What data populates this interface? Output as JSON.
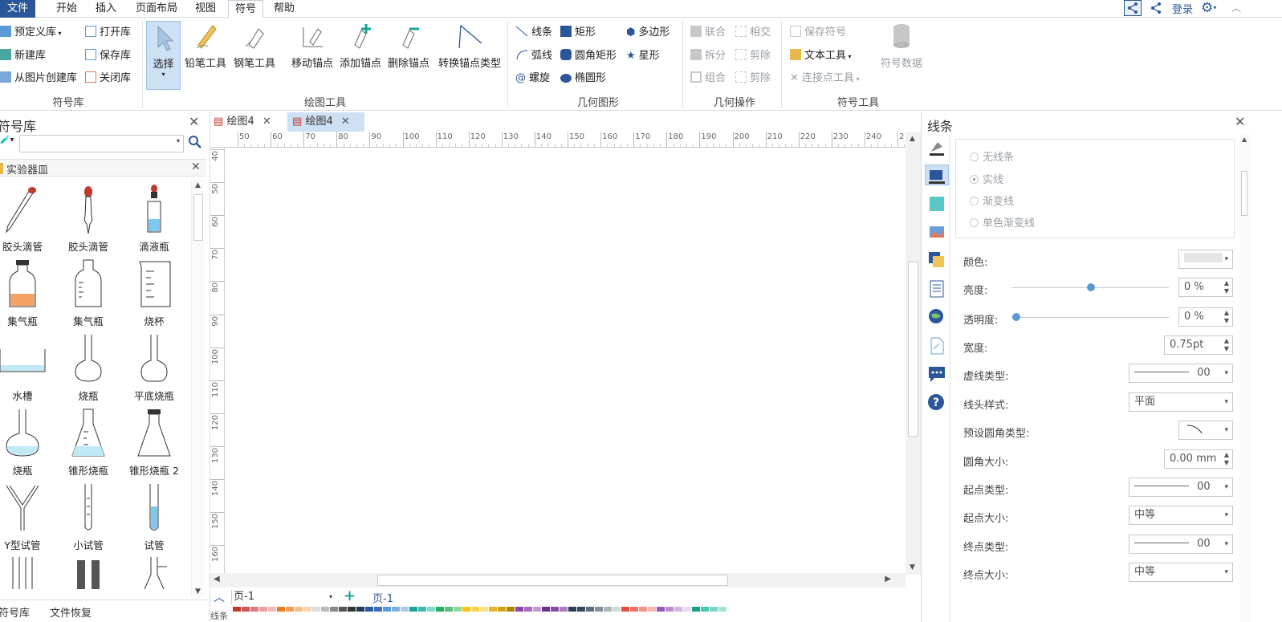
{
  "menubar": {
    "items": [
      "文件",
      "开始",
      "插入",
      "页面布局",
      "视图",
      "符号",
      "帮助"
    ],
    "login": "登录",
    "colors": {
      "file_bg": "#2b579a",
      "active_border": "#c6cdd8"
    }
  },
  "ribbon": {
    "symbol_library": {
      "group_label": "符号库",
      "items": [
        "预定义库",
        "新建库",
        "从图片创建库",
        "打开库",
        "保存库",
        "关闭库"
      ]
    },
    "drawing_tools": {
      "group_label": "绘图工具",
      "items": [
        "选择",
        "铅笔工具",
        "钢笔工具",
        "移动锚点",
        "添加锚点",
        "删除锚点",
        "转换锚点类型"
      ]
    },
    "geometry": {
      "group_label": "几何图形",
      "items": [
        "线条",
        "弧线",
        "螺旋",
        "矩形",
        "圆角矩形",
        "椭圆形",
        "多边形",
        "星形"
      ]
    },
    "geo_ops": {
      "group_label": "几何操作",
      "items": [
        "联合",
        "拆分",
        "组合",
        "相交",
        "剪除",
        "剪除"
      ]
    },
    "symbol_tools": {
      "group_label": "符号工具",
      "items": [
        "保存符号",
        "文本工具",
        "连接点工具",
        "符号数据"
      ]
    }
  },
  "left_panel": {
    "title": "符号库",
    "search_placeholder": "",
    "library_name": "实验器皿",
    "symbols": [
      "胶头滴管",
      "胶头滴管",
      "滴液瓶",
      "集气瓶",
      "集气瓶",
      "烧杯",
      "水槽",
      "烧瓶",
      "平底烧瓶",
      "烧瓶",
      "锥形烧瓶",
      "锥形烧瓶 2",
      "Y型试管",
      "小试管",
      "试管"
    ],
    "bottom_tabs": [
      "符号库",
      "文件恢复"
    ]
  },
  "canvas": {
    "tabs": [
      "绘图4",
      "绘图4"
    ],
    "ruler_h": [
      "50",
      "60",
      "70",
      "80",
      "90",
      "100",
      "110",
      "120",
      "130",
      "140",
      "150",
      "160",
      "170",
      "180",
      "190",
      "200",
      "210",
      "220",
      "230",
      "240",
      "2"
    ],
    "ruler_v": [
      "40",
      "50",
      "60",
      "70",
      "80",
      "90",
      "100",
      "110",
      "120",
      "130",
      "140",
      "150",
      "160"
    ],
    "page_combo": "页-1",
    "page_tab": "页-1",
    "status_left": "线条"
  },
  "right_panel": {
    "title": "线条",
    "line_options": [
      "无线条",
      "实线",
      "渐变线",
      "单色渐变线"
    ],
    "selected_option": "实线",
    "props": {
      "color_label": "颜色:",
      "brightness_label": "亮度:",
      "brightness_value": "0 %",
      "transparency_label": "透明度:",
      "transparency_value": "0 %",
      "width_label": "宽度:",
      "width_value": "0.75pt",
      "dash_label": "虚线类型:",
      "dash_value": "00",
      "cap_label": "线头样式:",
      "cap_value": "平面",
      "corner_type_label": "预设圆角类型:",
      "corner_size_label": "圆角大小:",
      "corner_size_value": "0.00 mm",
      "start_type_label": "起点类型:",
      "start_type_value": "00",
      "start_size_label": "起点大小:",
      "start_size_value": "中等",
      "end_type_label": "终点类型:",
      "end_type_value": "00",
      "end_size_label": "终点大小:",
      "end_size_value": "中等"
    }
  }
}
